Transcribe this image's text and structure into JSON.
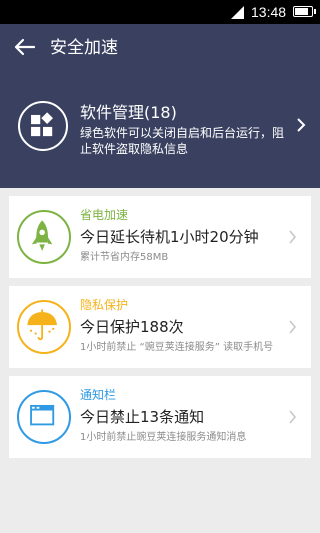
{
  "status_bar": {
    "time": "13:48"
  },
  "header": {
    "title": "安全加速"
  },
  "software_manager": {
    "title": "软件管理(18)",
    "description": "绿色软件可以关闭自启和后台运行，阻止软件盗取隐私信息",
    "icon": "apps-grid-icon"
  },
  "cards": [
    {
      "category": "省电加速",
      "headline": "今日延长待机1小时20分钟",
      "detail": "累计节省内存58MB",
      "icon": "rocket-icon",
      "color": "#7cb342"
    },
    {
      "category": "隐私保护",
      "headline": "今日保护188次",
      "detail": "1小时前禁止 “豌豆荚连接服务” 读取手机号",
      "icon": "umbrella-icon",
      "color": "#f5b21a"
    },
    {
      "category": "通知栏",
      "headline": "今日禁止13条通知",
      "detail": "1小时前禁止豌豆荚连接服务通知消息",
      "icon": "notification-window-icon",
      "color": "#2f9ae3"
    }
  ]
}
